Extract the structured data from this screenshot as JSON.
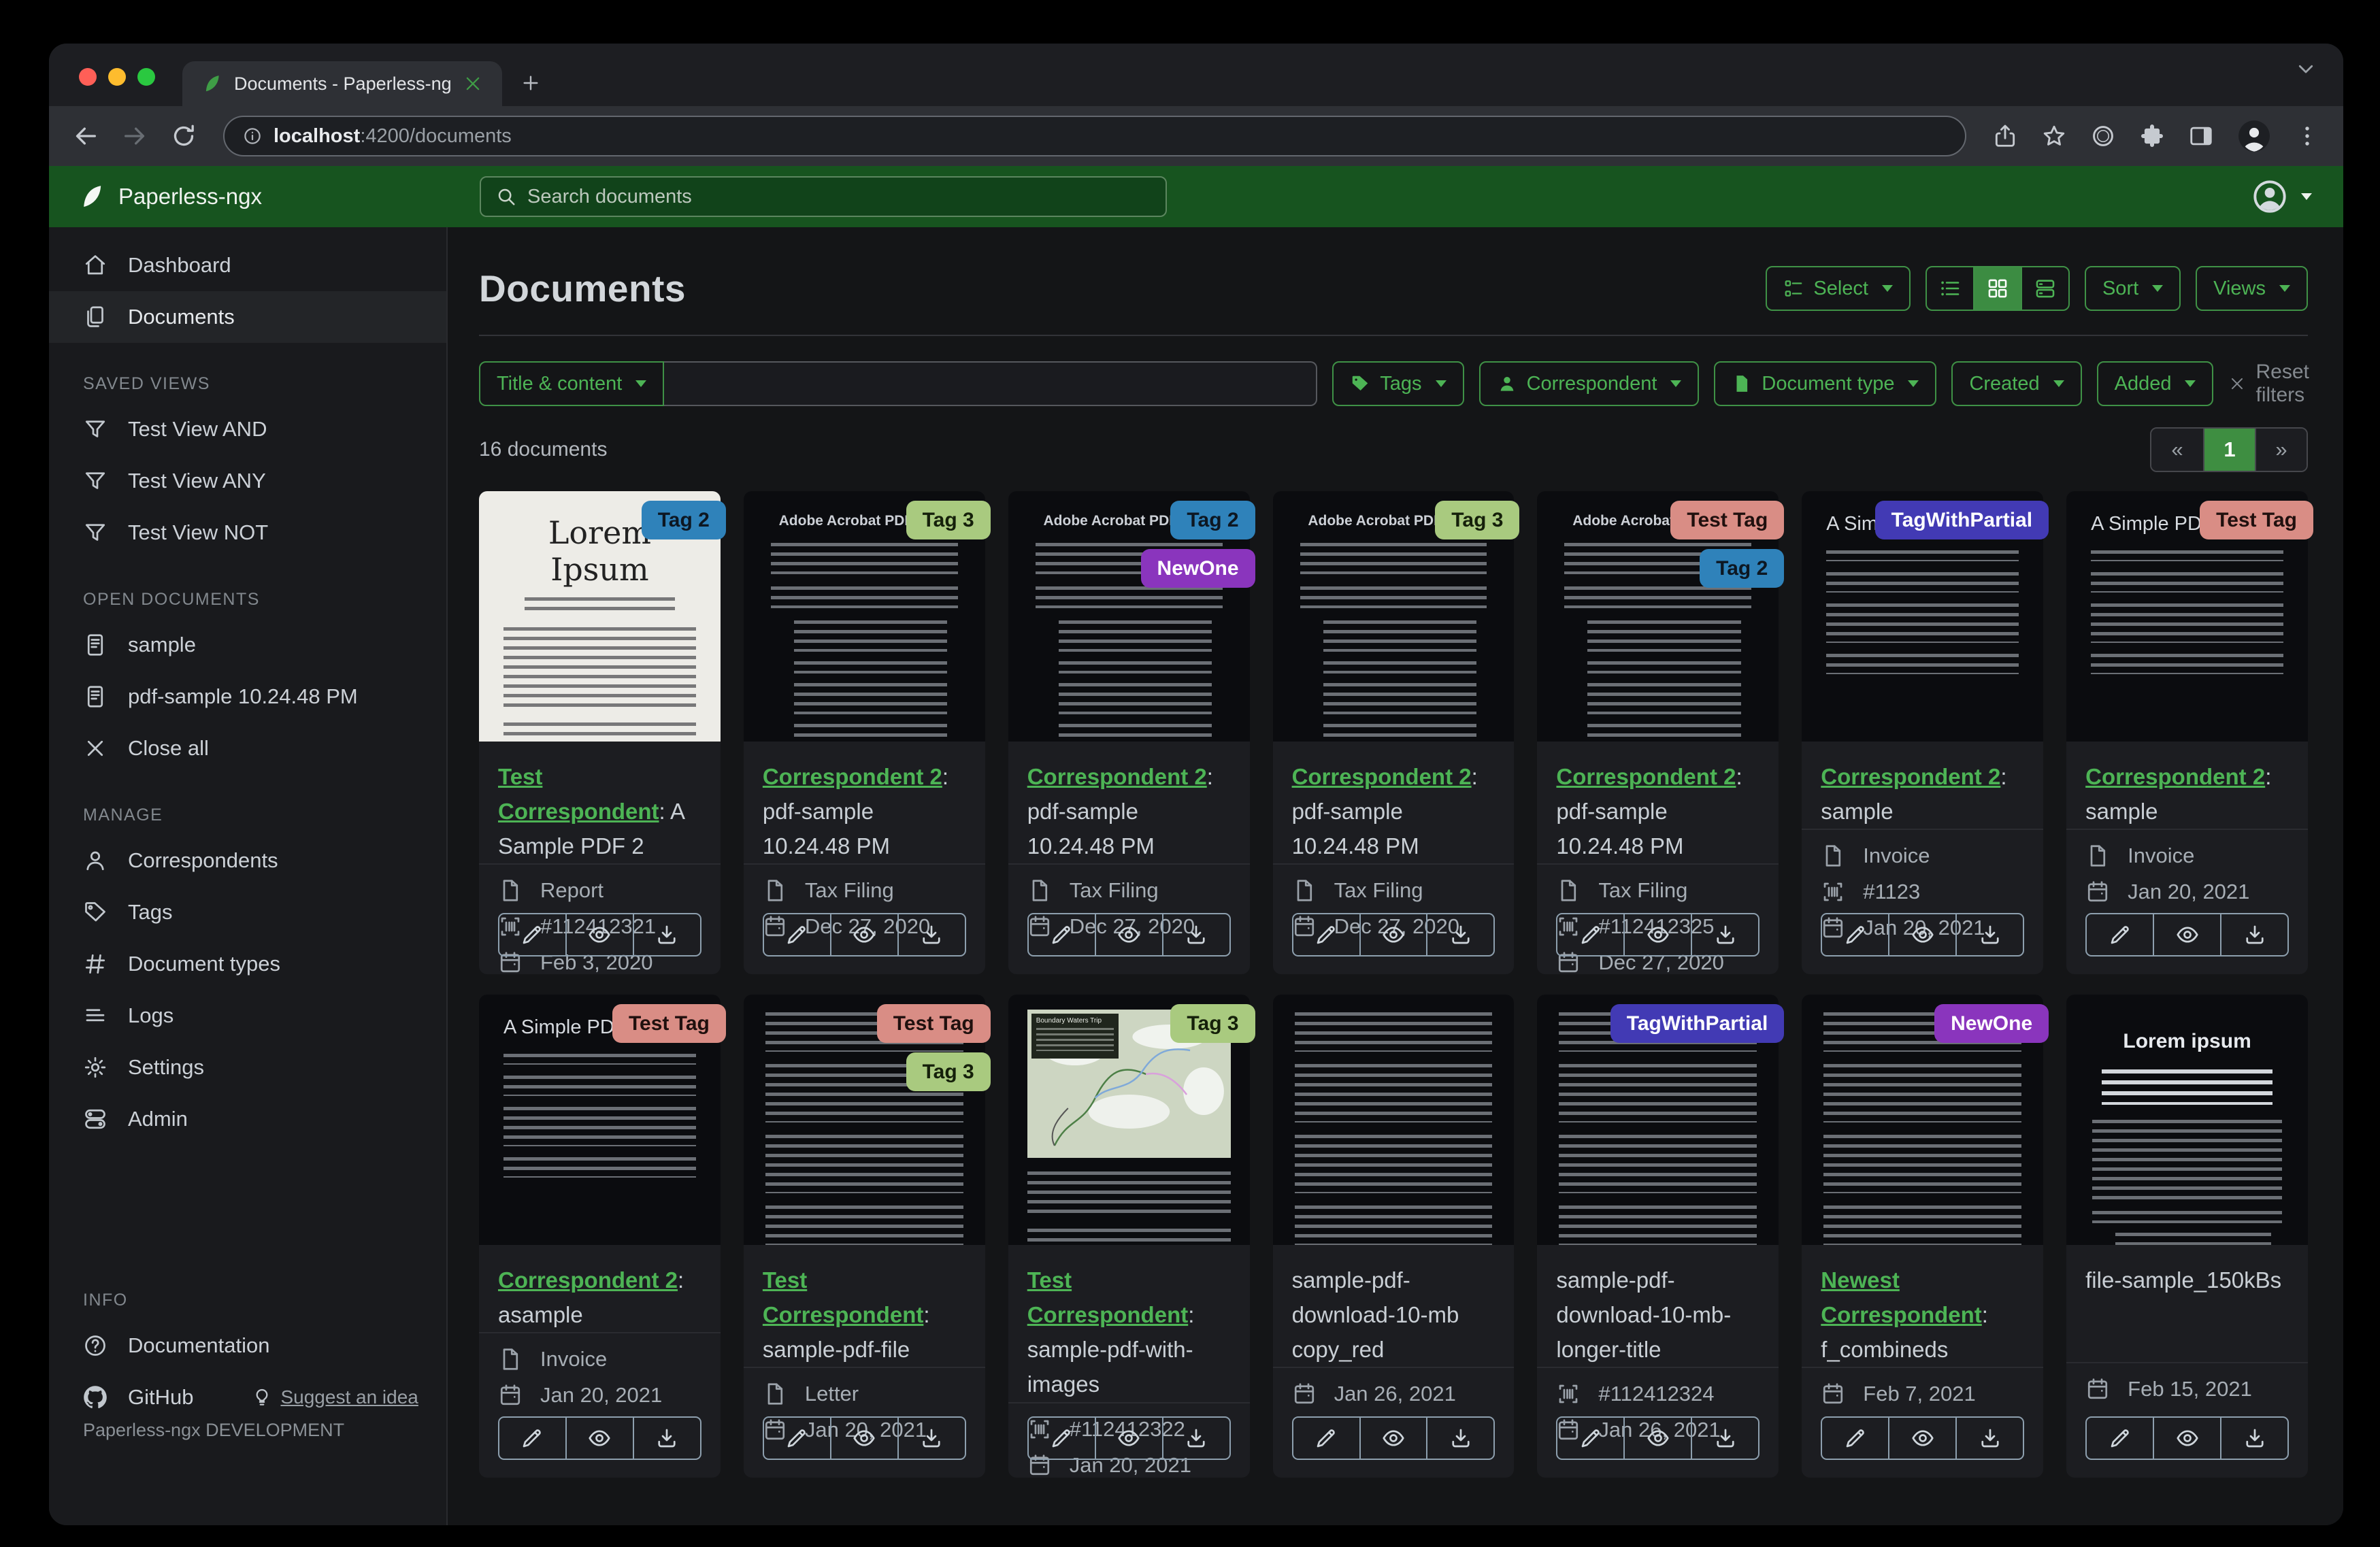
{
  "browser": {
    "tab_title": "Documents - Paperless-ngx",
    "url_host": "localhost",
    "url_rest": ":4200/documents"
  },
  "navbar": {
    "brand": "Paperless-ngx",
    "search_placeholder": "Search documents"
  },
  "sidebar": {
    "items_primary": [
      {
        "label": "Dashboard",
        "icon": "home",
        "active": false
      },
      {
        "label": "Documents",
        "icon": "docs",
        "active": true
      }
    ],
    "sections": [
      {
        "title": "SAVED VIEWS",
        "items": [
          {
            "label": "Test View AND",
            "icon": "funnel"
          },
          {
            "label": "Test View ANY",
            "icon": "funnel"
          },
          {
            "label": "Test View NOT",
            "icon": "funnel"
          }
        ]
      },
      {
        "title": "OPEN DOCUMENTS",
        "items": [
          {
            "label": "sample",
            "icon": "filetext"
          },
          {
            "label": "pdf-sample 10.24.48 PM",
            "icon": "filetext"
          },
          {
            "label": "Close all",
            "icon": "close"
          }
        ]
      },
      {
        "title": "MANAGE",
        "items": [
          {
            "label": "Correspondents",
            "icon": "person"
          },
          {
            "label": "Tags",
            "icon": "tag"
          },
          {
            "label": "Document types",
            "icon": "hash"
          },
          {
            "label": "Logs",
            "icon": "lines"
          },
          {
            "label": "Settings",
            "icon": "gear"
          },
          {
            "label": "Admin",
            "icon": "toggles"
          }
        ]
      },
      {
        "title": "INFO",
        "items": [
          {
            "label": "Documentation",
            "icon": "question"
          },
          {
            "label": "GitHub",
            "icon": "github",
            "extra": {
              "label": "Suggest an idea",
              "icon": "bulb"
            }
          }
        ]
      }
    ],
    "footer": "Paperless-ngx DEVELOPMENT"
  },
  "page": {
    "title": "Documents",
    "select_label": "Select",
    "sort_label": "Sort",
    "views_label": "Views",
    "count": "16 documents",
    "pagination": {
      "prev": "«",
      "current": "1",
      "next": "»"
    }
  },
  "filters": {
    "field": "Title & content",
    "input_value": "",
    "tags": "Tags",
    "correspondent": "Correspondent",
    "document_type": "Document type",
    "created": "Created",
    "added": "Added",
    "reset": "Reset filters"
  },
  "colors": {
    "brand_green": "#17541f",
    "accent_green": "#4db455",
    "link_green": "#4db455"
  },
  "tag_defs": {
    "tag2": {
      "label": "Tag 2",
      "bg": "#2f82ba",
      "fg": "#0d1722"
    },
    "tag3": {
      "label": "Tag 3",
      "bg": "#a9ca7f",
      "fg": "#15200a"
    },
    "testtag": {
      "label": "Test Tag",
      "bg": "#d98d85",
      "fg": "#20100e"
    },
    "newone": {
      "label": "NewOne",
      "bg": "#8a35bd",
      "fg": "#ffffff"
    },
    "tagwithpartial": {
      "label": "TagWithPartial",
      "bg": "#423ab4",
      "fg": "#ffffff"
    }
  },
  "thumb_headings": {
    "lorem_white": "Lorem Ipsum",
    "adobe_dark": "Adobe Acrobat PDF Files",
    "simple_dark": "A Simple PDF File",
    "lorem_dark_center": "Lorem ipsum",
    "map_dark": "Boundary Waters Trip"
  },
  "cards": [
    {
      "thumb": "lorem_white",
      "tags": [
        "tag2"
      ],
      "link": "Test Correspondent",
      "rest": ": A Sample PDF 2",
      "meta": [
        {
          "icon": "doc",
          "text": "Report"
        },
        {
          "icon": "asn",
          "text": "#112412321"
        },
        {
          "icon": "cal",
          "text": "Feb 3, 2020"
        }
      ]
    },
    {
      "thumb": "adobe_dark",
      "tags": [
        "tag3"
      ],
      "link": "Correspondent 2",
      "rest": ": pdf-sample 10.24.48 PM",
      "meta": [
        {
          "icon": "doc",
          "text": "Tax Filing"
        },
        {
          "icon": "cal",
          "text": "Dec 27, 2020"
        }
      ]
    },
    {
      "thumb": "adobe_dark",
      "tags": [
        "tag2",
        "newone"
      ],
      "link": "Correspondent 2",
      "rest": ": pdf-sample 10.24.48 PM",
      "meta": [
        {
          "icon": "doc",
          "text": "Tax Filing"
        },
        {
          "icon": "cal",
          "text": "Dec 27, 2020"
        }
      ]
    },
    {
      "thumb": "adobe_dark",
      "tags": [
        "tag3"
      ],
      "link": "Correspondent 2",
      "rest": ": pdf-sample 10.24.48 PM",
      "meta": [
        {
          "icon": "doc",
          "text": "Tax Filing"
        },
        {
          "icon": "cal",
          "text": "Dec 27, 2020"
        }
      ]
    },
    {
      "thumb": "adobe_dark",
      "tags": [
        "testtag",
        "tag2"
      ],
      "link": "Correspondent 2",
      "rest": ": pdf-sample 10.24.48 PM",
      "meta": [
        {
          "icon": "doc",
          "text": "Tax Filing"
        },
        {
          "icon": "asn",
          "text": "#112412325"
        },
        {
          "icon": "cal",
          "text": "Dec 27, 2020"
        }
      ]
    },
    {
      "thumb": "simple_dark",
      "tags": [
        "tagwithpartial"
      ],
      "link": "Correspondent 2",
      "rest": ": sample",
      "meta": [
        {
          "icon": "doc",
          "text": "Invoice"
        },
        {
          "icon": "asn",
          "text": "#1123"
        },
        {
          "icon": "cal",
          "text": "Jan 20, 2021"
        }
      ]
    },
    {
      "thumb": "simple_dark",
      "tags": [
        "testtag"
      ],
      "link": "Correspondent 2",
      "rest": ": sample",
      "meta": [
        {
          "icon": "doc",
          "text": "Invoice"
        },
        {
          "icon": "cal",
          "text": "Jan 20, 2021"
        }
      ]
    },
    {
      "thumb": "simple_dark",
      "tags": [
        "testtag"
      ],
      "link": "Correspondent 2",
      "rest": ": asample",
      "meta": [
        {
          "icon": "doc",
          "text": "Invoice"
        },
        {
          "icon": "cal",
          "text": "Jan 20, 2021"
        }
      ]
    },
    {
      "thumb": "dense_dark",
      "tags": [
        "testtag",
        "tag3"
      ],
      "link": "Test Correspondent",
      "rest": ": sample-pdf-file",
      "meta": [
        {
          "icon": "doc",
          "text": "Letter"
        },
        {
          "icon": "cal",
          "text": "Jan 20, 2021"
        }
      ]
    },
    {
      "thumb": "map_dark",
      "tags": [
        "tag3"
      ],
      "link": "Test Correspondent",
      "rest": ": sample-pdf-with-images",
      "meta": [
        {
          "icon": "asn",
          "text": "#112412322"
        },
        {
          "icon": "cal",
          "text": "Jan 20, 2021"
        }
      ]
    },
    {
      "thumb": "dense_dark",
      "tags": [],
      "link": null,
      "rest": "sample-pdf-download-10-mb copy_red",
      "meta": [
        {
          "icon": "cal",
          "text": "Jan 26, 2021"
        }
      ]
    },
    {
      "thumb": "dense_dark",
      "tags": [
        "tagwithpartial"
      ],
      "link": null,
      "rest": "sample-pdf-download-10-mb-longer-title",
      "meta": [
        {
          "icon": "asn",
          "text": "#112412324"
        },
        {
          "icon": "cal",
          "text": "Jan 26, 2021"
        }
      ]
    },
    {
      "thumb": "dense_dark",
      "tags": [
        "newone"
      ],
      "link": "Newest Correspondent",
      "rest": ": f_combineds",
      "meta": [
        {
          "icon": "cal",
          "text": "Feb 7, 2021"
        }
      ]
    },
    {
      "thumb": "lorem_dark_center",
      "tags": [],
      "link": null,
      "rest": "file-sample_150kBs",
      "meta": [
        {
          "icon": "cal",
          "text": "Feb 15, 2021"
        }
      ]
    }
  ]
}
